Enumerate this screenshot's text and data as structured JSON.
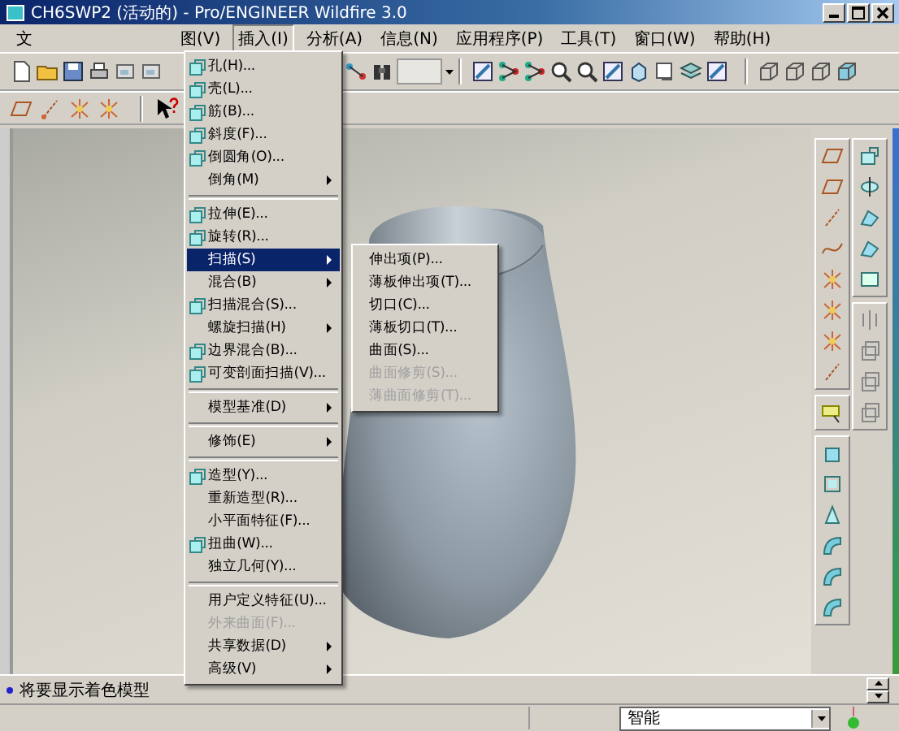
{
  "window": {
    "title": "CH6SWP2 (活动的) - Pro/ENGINEER Wildfire 3.0"
  },
  "menubar": [
    {
      "label": "文",
      "selected": false
    },
    {
      "label": "图(V)",
      "selected": false
    },
    {
      "label": "插入(I)",
      "selected": true
    },
    {
      "label": "分析(A)",
      "selected": false
    },
    {
      "label": "信息(N)",
      "selected": false
    },
    {
      "label": "应用程序(P)",
      "selected": false
    },
    {
      "label": "工具(T)",
      "selected": false
    },
    {
      "label": "窗口(W)",
      "selected": false
    },
    {
      "label": "帮助(H)",
      "selected": false
    }
  ],
  "insert_menu": {
    "groups": [
      [
        {
          "label": "孔(H)...",
          "has_icon": true,
          "submenu": false,
          "selected": false,
          "disabled": false
        },
        {
          "label": "壳(L)...",
          "has_icon": true,
          "submenu": false,
          "selected": false,
          "disabled": false
        },
        {
          "label": "筋(B)...",
          "has_icon": true,
          "submenu": false,
          "selected": false,
          "disabled": false
        },
        {
          "label": "斜度(F)...",
          "has_icon": true,
          "submenu": false,
          "selected": false,
          "disabled": false
        },
        {
          "label": "倒圆角(O)...",
          "has_icon": true,
          "submenu": false,
          "selected": false,
          "disabled": false
        },
        {
          "label": "倒角(M)",
          "has_icon": false,
          "submenu": true,
          "selected": false,
          "disabled": false
        }
      ],
      [
        {
          "label": "拉伸(E)...",
          "has_icon": true,
          "submenu": false,
          "selected": false,
          "disabled": false
        },
        {
          "label": "旋转(R)...",
          "has_icon": true,
          "submenu": false,
          "selected": false,
          "disabled": false
        },
        {
          "label": "扫描(S)",
          "has_icon": false,
          "submenu": true,
          "selected": true,
          "disabled": false
        },
        {
          "label": "混合(B)",
          "has_icon": false,
          "submenu": true,
          "selected": false,
          "disabled": false
        },
        {
          "label": "扫描混合(S)...",
          "has_icon": true,
          "submenu": false,
          "selected": false,
          "disabled": false
        },
        {
          "label": "螺旋扫描(H)",
          "has_icon": false,
          "submenu": true,
          "selected": false,
          "disabled": false
        },
        {
          "label": "边界混合(B)...",
          "has_icon": true,
          "submenu": false,
          "selected": false,
          "disabled": false
        },
        {
          "label": "可变剖面扫描(V)...",
          "has_icon": true,
          "submenu": false,
          "selected": false,
          "disabled": false
        }
      ],
      [
        {
          "label": "模型基准(D)",
          "has_icon": false,
          "submenu": true,
          "selected": false,
          "disabled": false
        }
      ],
      [
        {
          "label": "修饰(E)",
          "has_icon": false,
          "submenu": true,
          "selected": false,
          "disabled": false
        }
      ],
      [
        {
          "label": "造型(Y)...",
          "has_icon": true,
          "submenu": false,
          "selected": false,
          "disabled": false
        },
        {
          "label": "重新造型(R)...",
          "has_icon": false,
          "submenu": false,
          "selected": false,
          "disabled": false
        },
        {
          "label": "小平面特征(F)...",
          "has_icon": false,
          "submenu": false,
          "selected": false,
          "disabled": false
        },
        {
          "label": "扭曲(W)...",
          "has_icon": true,
          "submenu": false,
          "selected": false,
          "disabled": false
        },
        {
          "label": "独立几何(Y)...",
          "has_icon": false,
          "submenu": false,
          "selected": false,
          "disabled": false
        }
      ],
      [
        {
          "label": "用户定义特征(U)...",
          "has_icon": false,
          "submenu": false,
          "selected": false,
          "disabled": false
        },
        {
          "label": "外来曲面(F)...",
          "has_icon": false,
          "submenu": false,
          "selected": false,
          "disabled": true
        },
        {
          "label": "共享数据(D)",
          "has_icon": false,
          "submenu": true,
          "selected": false,
          "disabled": false
        },
        {
          "label": "高级(V)",
          "has_icon": false,
          "submenu": true,
          "selected": false,
          "disabled": false
        }
      ]
    ]
  },
  "sweep_submenu": {
    "items": [
      {
        "label": "伸出项(P)...",
        "disabled": false
      },
      {
        "label": "薄板伸出项(T)...",
        "disabled": false
      },
      {
        "label": "切口(C)...",
        "disabled": false
      },
      {
        "label": "薄板切口(T)...",
        "disabled": false
      },
      {
        "label": "曲面(S)...",
        "disabled": false
      },
      {
        "label": "曲面修剪(S)...",
        "disabled": true
      },
      {
        "label": "薄曲面修剪(T)...",
        "disabled": true
      }
    ]
  },
  "message_area": {
    "message": "将要显示着色模型"
  },
  "status_bar": {
    "filter": {
      "value": "智能"
    }
  }
}
